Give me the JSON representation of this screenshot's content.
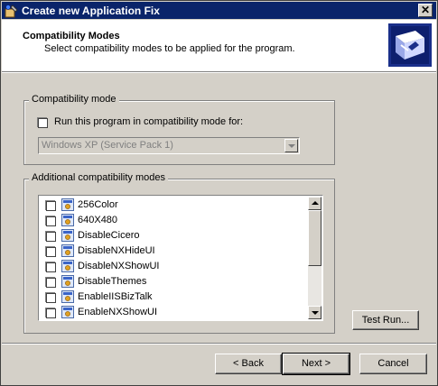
{
  "window": {
    "title": "Create new Application Fix",
    "close_glyph": "✕"
  },
  "header": {
    "title": "Compatibility Modes",
    "subtitle": "Select compatibility modes to be applied for the program."
  },
  "compat_mode": {
    "group_label": "Compatibility mode",
    "checkbox_label": "Run this program in compatibility mode for:",
    "checked": false,
    "os_selected": "Windows XP (Service Pack 1)"
  },
  "additional": {
    "group_label": "Additional compatibility modes",
    "items": [
      {
        "label": "256Color",
        "checked": false
      },
      {
        "label": "640X480",
        "checked": false
      },
      {
        "label": "DisableCicero",
        "checked": false
      },
      {
        "label": "DisableNXHideUI",
        "checked": false
      },
      {
        "label": "DisableNXShowUI",
        "checked": false
      },
      {
        "label": "DisableThemes",
        "checked": false
      },
      {
        "label": "EnableIISBizTalk",
        "checked": false
      },
      {
        "label": "EnableNXShowUI",
        "checked": false
      }
    ]
  },
  "buttons": {
    "test_run": "Test Run...",
    "back": "< Back",
    "next": "Next >",
    "cancel": "Cancel"
  },
  "colors": {
    "titlebar": "#0a246a",
    "face": "#d4d0c8"
  }
}
